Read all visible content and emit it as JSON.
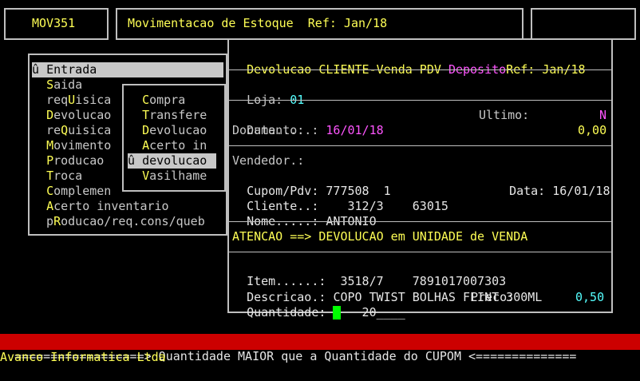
{
  "header": {
    "program": "MOV351",
    "title": "Movimentacao de Estoque  Ref: Jan/18"
  },
  "menu": {
    "items": [
      {
        "pre": "û ",
        "hot": "E",
        "post": "ntrada"
      },
      {
        "pre": "  ",
        "hot": "S",
        "post": "aida"
      },
      {
        "pre": "  req",
        "hot": "U",
        "post": "isica"
      },
      {
        "pre": "  ",
        "hot": "D",
        "post": "evolucao"
      },
      {
        "pre": "  re",
        "hot": "Q",
        "post": "uisica"
      },
      {
        "pre": "  ",
        "hot": "M",
        "post": "ovimento"
      },
      {
        "pre": "  ",
        "hot": "P",
        "post": "roducao"
      },
      {
        "pre": "  ",
        "hot": "T",
        "post": "roca"
      },
      {
        "pre": "  ",
        "hot": "C",
        "post": "omplemen"
      },
      {
        "pre": "  ",
        "hot": "A",
        "post": "certo inventario"
      },
      {
        "pre": "  p",
        "hot": "R",
        "post": "oducao/req.cons/queb"
      }
    ]
  },
  "submenu": {
    "items": [
      {
        "pre": "  ",
        "hot": "C",
        "post": "ompra"
      },
      {
        "pre": "  ",
        "hot": "T",
        "post": "ransfere"
      },
      {
        "pre": "  ",
        "hot": "D",
        "post": "evolucao"
      },
      {
        "pre": "  ",
        "hot": "A",
        "post": "certo in"
      },
      {
        "pre": "û ",
        "hot": "",
        "post": "devolucao"
      },
      {
        "pre": "  ",
        "hot": "V",
        "post": "asilhame"
      }
    ]
  },
  "dialog": {
    "title_a": "Devolucao CLIENTE-Venda PDV ",
    "title_b": "Deposito",
    "title_c": "Ref: Jan/18",
    "loja_label": "Loja: ",
    "loja_value": "01",
    "data_label": "Data.....: ",
    "data_value": "16/01/18",
    "ultimo_label": "Ultimo:",
    "ultimo_value": "N",
    "documento_label": "Documento:",
    "documento_value": "0,00",
    "vendedor_label": "Vendedor.:",
    "cupom_label": "Cupom/Pdv: ",
    "cupom_value": "777508  1",
    "cupom_data_label": "Data: ",
    "cupom_data_value": "16/01/18",
    "cliente_label": "Cliente..: ",
    "cliente_value": "   312/3    63015",
    "nome_label": "Nome.....: ",
    "nome_value": "ANTONIO",
    "atencao": "ATENCAO ==> DEVOLUCAO em UNIDADE de VENDA",
    "item_label": "Item......: ",
    "item_value": " 3518/7    7891017007303",
    "descricao_label": "Descricao.: ",
    "descricao_value": "COPO TWIST BOLHAS FLINT 300ML",
    "quantidade_label": "Quantidade: ",
    "quantidade_value": "    20____",
    "preco_label": "Preco:",
    "preco_value": "0,50"
  },
  "status": {
    "message": "==================> Quantidade MAIOR que a Quantidade do CUPOM <==============",
    "message_bg": "#cc0000",
    "footer": "Avanco Informatica Ltda"
  },
  "colors": {
    "highlight": "#ffff55",
    "magenta": "#ff55ff",
    "cyan": "#55ffff",
    "cursor": "#00ff00"
  }
}
